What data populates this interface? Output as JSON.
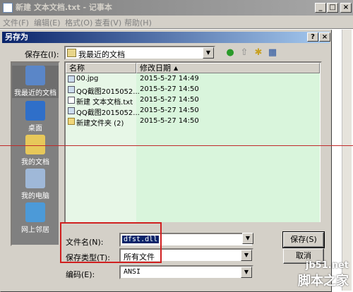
{
  "notepad": {
    "title": "新建 文本文档.txt - 记事本",
    "menu": [
      "文件(F)",
      "编辑(E)",
      "格式(O)",
      "查看(V)",
      "帮助(H)"
    ]
  },
  "dialog": {
    "title": "另存为",
    "help_btn": "?",
    "close_btn": "×",
    "save_in_label": "保存在(I):",
    "save_in_value": "我最近的文档",
    "places": [
      "我最近的文档",
      "桌面",
      "我的文档",
      "我的电脑",
      "网上邻居"
    ],
    "columns": {
      "name": "名称",
      "modified": "修改日期"
    },
    "files": [
      {
        "name": "00.jpg",
        "date": "2015-5-27 14:49",
        "icon": "image-icon"
      },
      {
        "name": "QQ截图2015052...",
        "date": "2015-5-27 14:50",
        "icon": "image-icon"
      },
      {
        "name": "新建 文本文档.txt",
        "date": "2015-5-27 14:50",
        "icon": "text-file-icon"
      },
      {
        "name": "QQ截图2015052...",
        "date": "2015-5-27 14:50",
        "icon": "image-icon"
      },
      {
        "name": "新建文件夹 (2)",
        "date": "2015-5-27 14:50",
        "icon": "folder-icon"
      }
    ],
    "filename_label": "文件名(N):",
    "filename_value": "dfst.dll",
    "filetype_label": "保存类型(T):",
    "filetype_value": "所有文件",
    "encoding_label": "编码(E):",
    "encoding_value": "ANSI",
    "save_button": "保存(S)",
    "cancel_button": "取消"
  },
  "watermark": {
    "site": "jb51.net",
    "name": "脚本之家"
  },
  "colors": {
    "title_active": "#0a246a",
    "list_bg": "#d9f5dc",
    "highlight": "#d02020"
  }
}
